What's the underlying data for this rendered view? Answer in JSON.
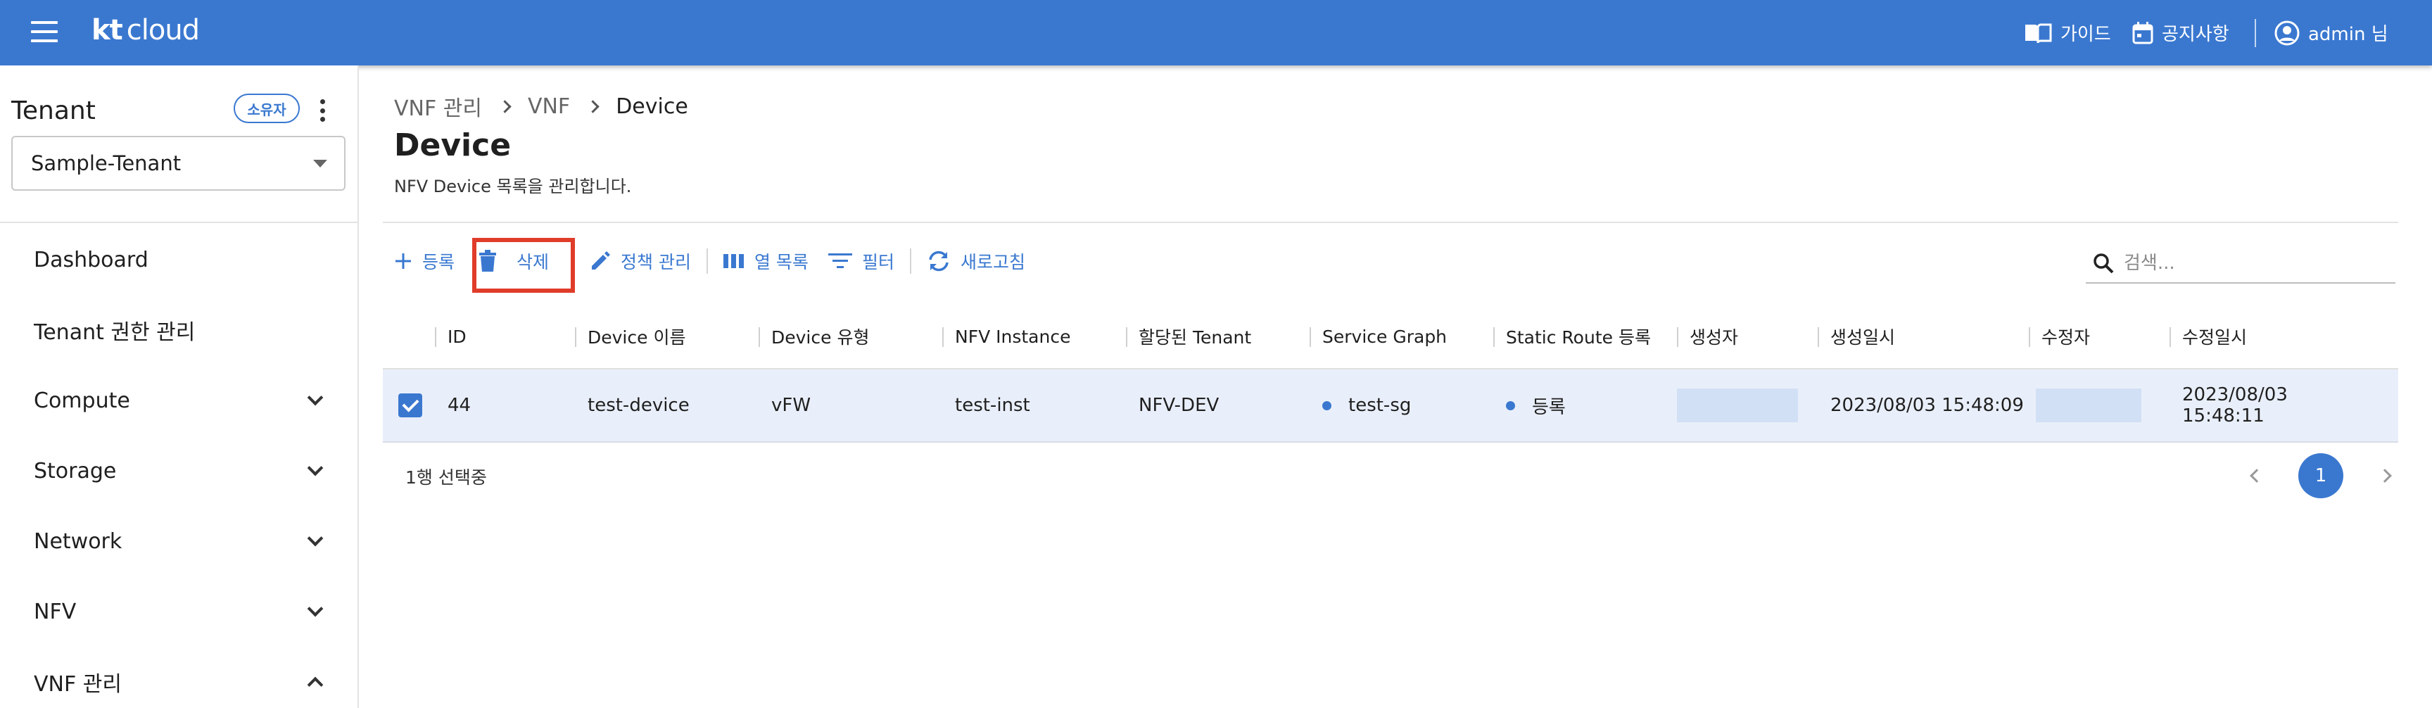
{
  "header": {
    "logo_kt": "kt",
    "logo_cloud": "cloud",
    "guide_label": "가이드",
    "notice_label": "공지사항",
    "user_label": "admin 님"
  },
  "sidebar": {
    "tenant_title": "Tenant",
    "owner_badge": "소유자",
    "tenant_selected": "Sample-Tenant",
    "items": [
      {
        "label": "Dashboard"
      },
      {
        "label": "Tenant 권한 관리"
      },
      {
        "label": "Compute"
      },
      {
        "label": "Storage"
      },
      {
        "label": "Network"
      },
      {
        "label": "NFV"
      },
      {
        "label": "VNF 관리"
      }
    ]
  },
  "breadcrumb": [
    "VNF 관리",
    "VNF",
    "Device"
  ],
  "page": {
    "title": "Device",
    "description": "NFV Device 목록을 관리합니다."
  },
  "toolbar": {
    "register": "등록",
    "delete": "삭제",
    "policy": "정책 관리",
    "columns": "열 목록",
    "filter": "필터",
    "refresh": "새로고침"
  },
  "search": {
    "placeholder": "검색..."
  },
  "table": {
    "headers": [
      "ID",
      "Device 이름",
      "Device 유형",
      "NFV Instance",
      "할당된 Tenant",
      "Service Graph",
      "Static Route 등록",
      "생성자",
      "생성일시",
      "수정자",
      "수정일시"
    ],
    "rows": [
      {
        "id": "44",
        "device_name": "test-device",
        "device_type": "vFW",
        "nfv_instance": "test-inst",
        "tenant": "NFV-DEV",
        "service_graph": "test-sg",
        "static_route": "등록",
        "creator": "",
        "created_at": "2023/08/03 15:48:09",
        "modifier": "",
        "modified_at": "2023/08/03 15:48:11",
        "selected": true
      }
    ]
  },
  "footer": {
    "selection_text": "1행 선택중",
    "current_page": "1"
  },
  "colors": {
    "primary": "#3a78d0",
    "highlight": "#e03c2a",
    "row_selected": "#e9effa"
  }
}
